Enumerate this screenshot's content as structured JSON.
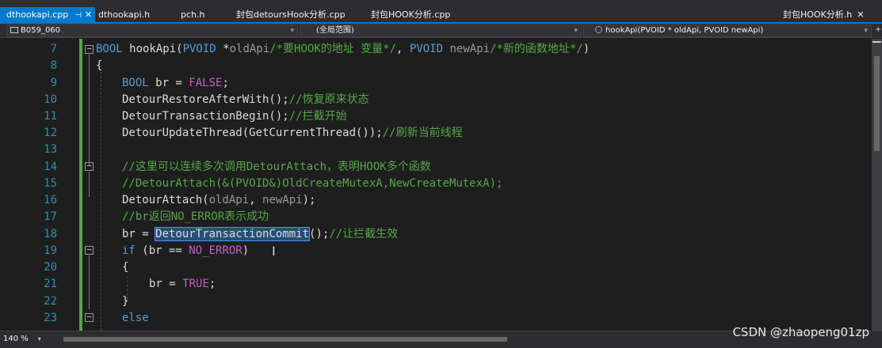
{
  "tabs": [
    {
      "label": "dthookapi.cpp",
      "active": true
    },
    {
      "label": "dthookapi.h"
    },
    {
      "label": "pch.h"
    },
    {
      "label": "封包detoursHook分析.cpp"
    },
    {
      "label": "封包HOOK分析.cpp"
    },
    {
      "label": "封包HOOK分析.h"
    }
  ],
  "nav": {
    "project": "B059_060",
    "scope": "(全局范围)",
    "function": "hookApi(PVOID * oldApi, PVOID newApi)"
  },
  "lines": [
    {
      "n": "7"
    },
    {
      "n": "8"
    },
    {
      "n": "9"
    },
    {
      "n": "10"
    },
    {
      "n": "11"
    },
    {
      "n": "12"
    },
    {
      "n": "13"
    },
    {
      "n": "14"
    },
    {
      "n": "15"
    },
    {
      "n": "16"
    },
    {
      "n": "17"
    },
    {
      "n": "18"
    },
    {
      "n": "19"
    },
    {
      "n": "20"
    },
    {
      "n": "21"
    },
    {
      "n": "22"
    },
    {
      "n": "23"
    }
  ],
  "code": {
    "l7": {
      "bool": "BOOL",
      "name": " hookApi(",
      "pvoid1": "PVOID",
      "star": " *",
      "p1": "oldApi",
      "c1": "/*要HOOK的地址 变量*/",
      "comma": ", ",
      "pvoid2": "PVOID",
      "sp": " ",
      "p2": "newApi",
      "c2": "/*新的函数地址*/",
      "close": ")"
    },
    "l8": "{",
    "l9": {
      "kw": "BOOL",
      "mid": " br = ",
      "val": "FALSE",
      "end": ";"
    },
    "l10": {
      "fn": "DetourRestoreAfterWith();",
      "cm": "//恢复原来状态"
    },
    "l11": {
      "fn": "DetourTransactionBegin();",
      "cm": "//拦截开始"
    },
    "l12": {
      "fn": "DetourUpdateThread(GetCurrentThread());",
      "cm": "//刷新当前线程"
    },
    "l14": "//这里可以连续多次调用DetourAttach，表明HOOK多个函数",
    "l15": "//DetourAttach(&(PVOID&)OldCreateMutexA,NewCreateMutexA);",
    "l16": {
      "fn": "DetourAttach(",
      "p1": "oldApi",
      "sep": ", ",
      "p2": "newApi",
      "end": ");"
    },
    "l17": "//br返回NO_ERROR表示成功",
    "l18": {
      "pre": "br = ",
      "sel": "DetourTransactionCommit",
      "post": "();",
      "cm": "//让拦截生效"
    },
    "l19": {
      "kw": "if",
      "mid": " (br == ",
      "mac": "NO_ERROR",
      "end": ")"
    },
    "l20": "{",
    "l21": {
      "pre": "br = ",
      "val": "TRUE",
      "end": ";"
    },
    "l22": "}",
    "l23": "else"
  },
  "status": {
    "zoom": "140 %"
  },
  "watermark": "CSDN @zhaopeng01zp",
  "colors": {
    "accent": "#007acc",
    "keyword": "#569cd6",
    "comment": "#57a64a",
    "linenumber": "#2b91af",
    "macro": "#bd63c5"
  }
}
